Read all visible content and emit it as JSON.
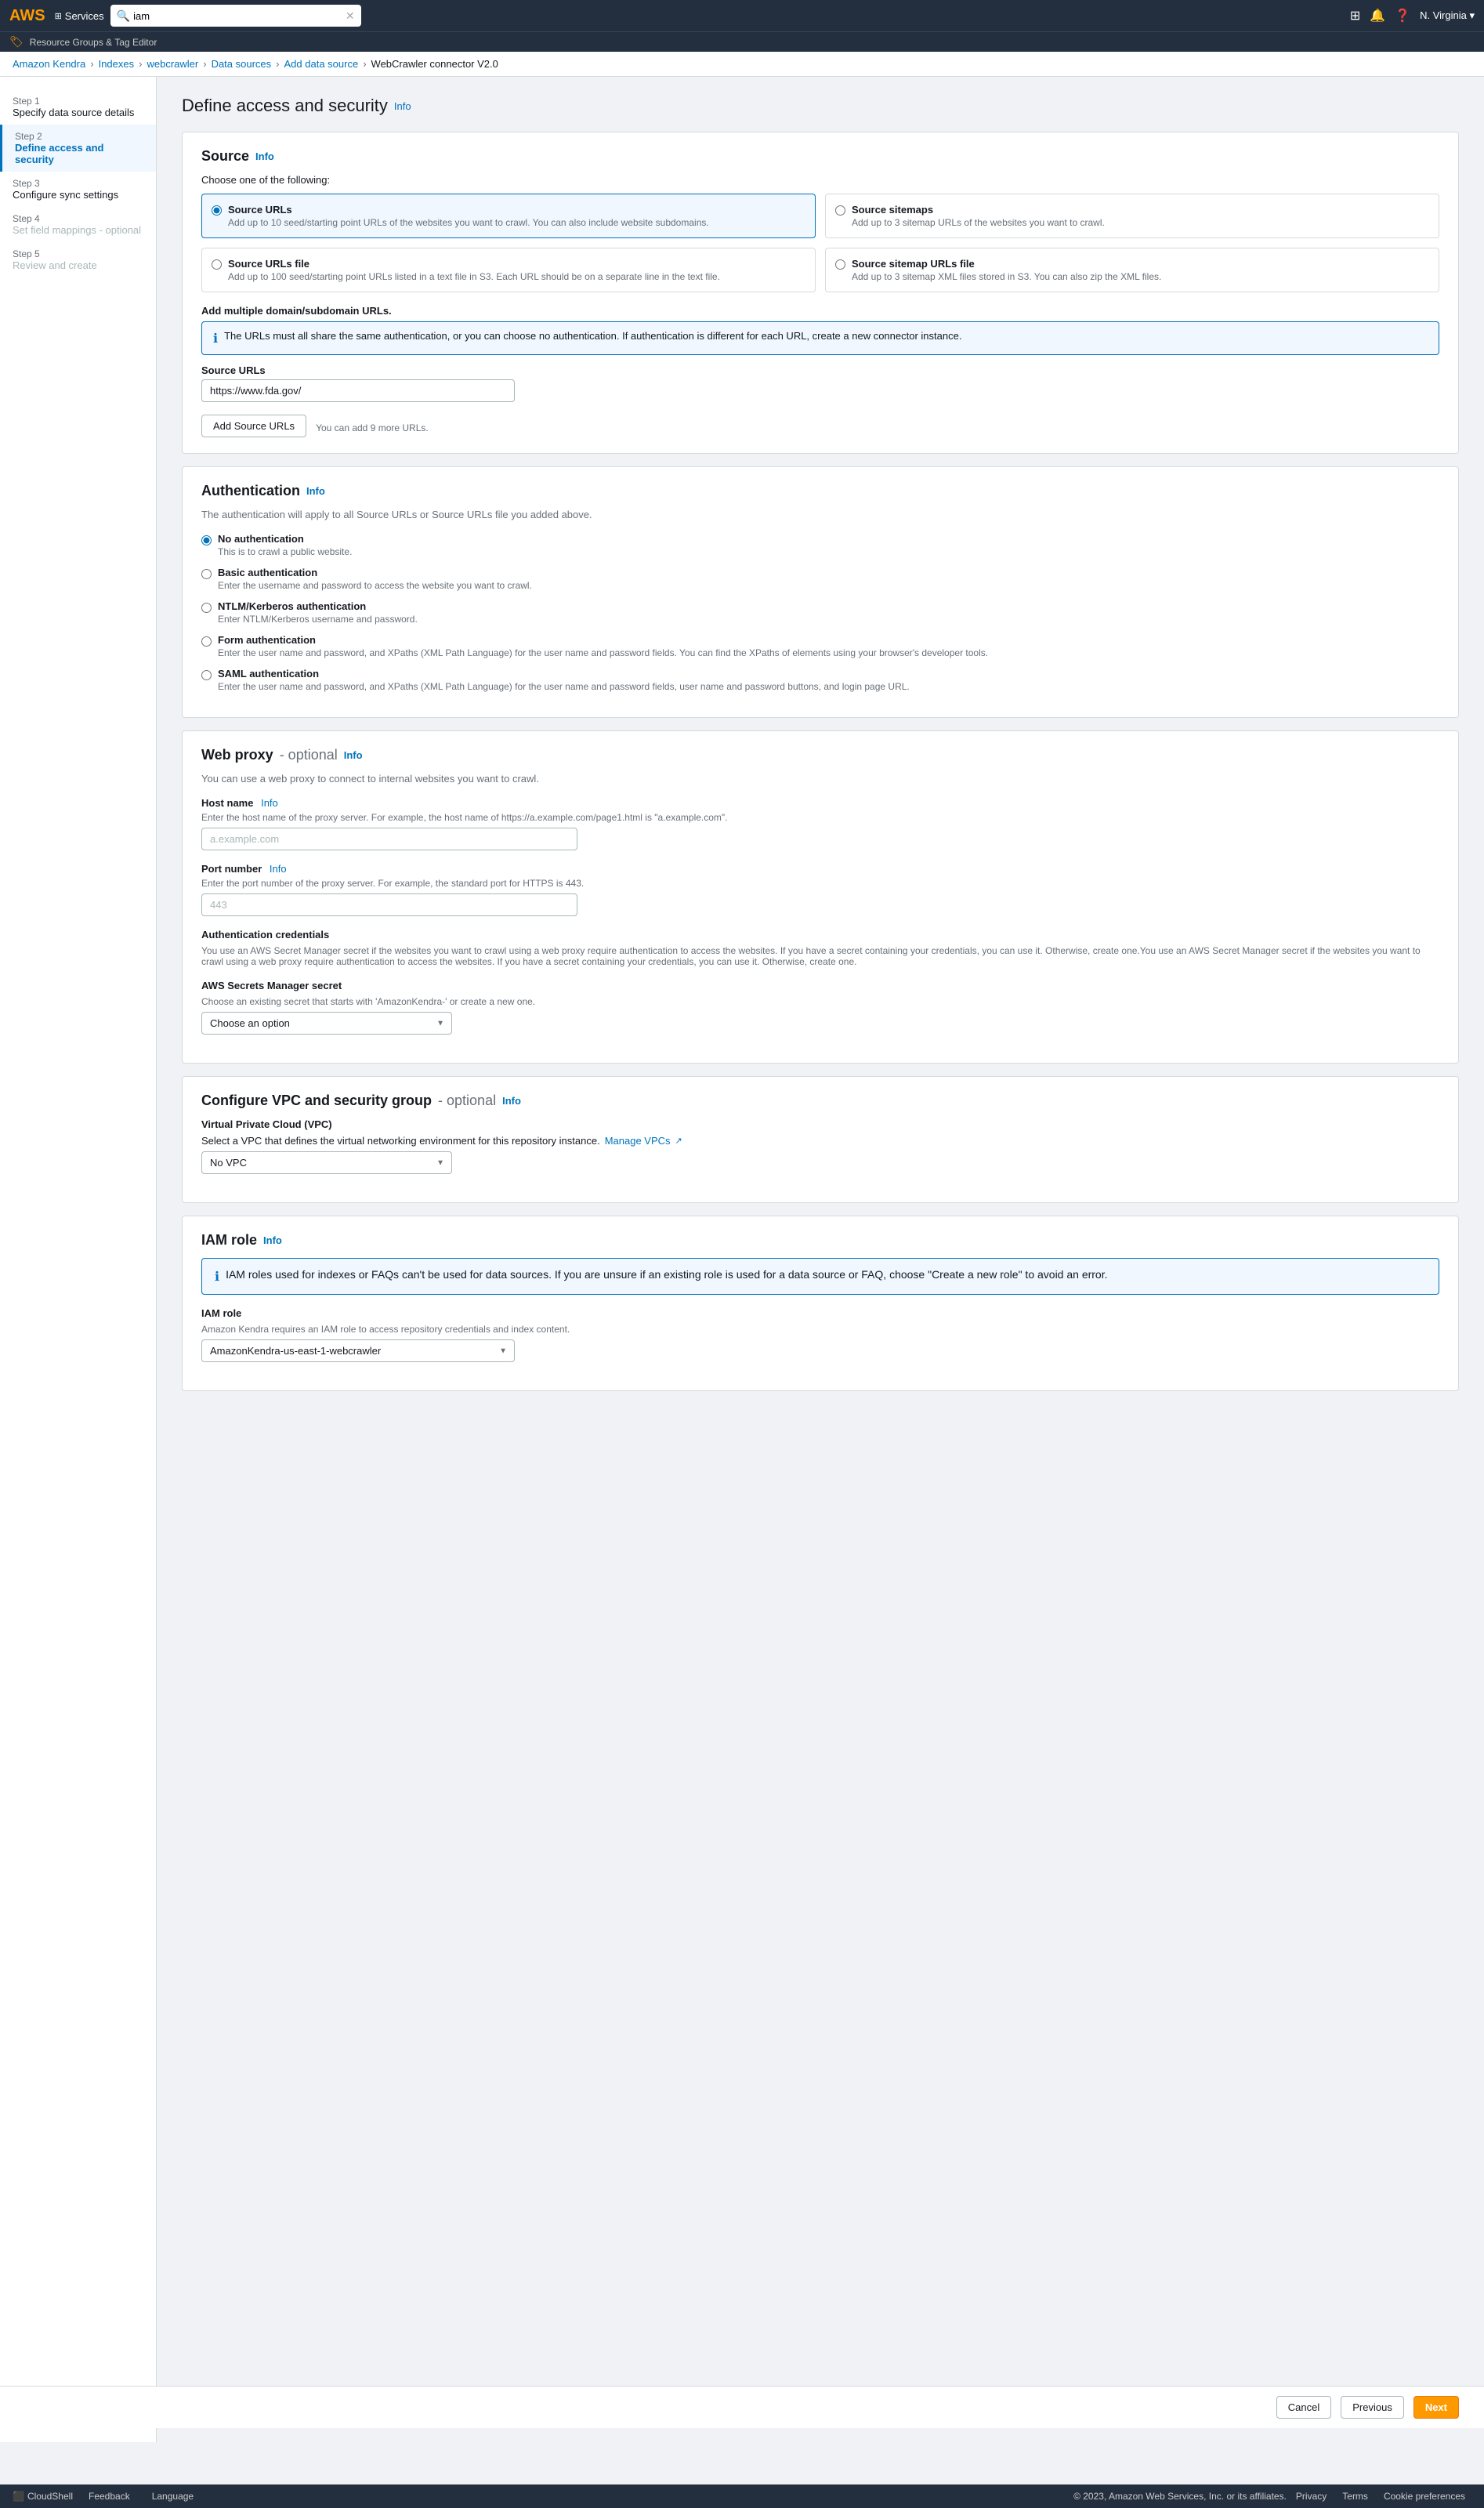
{
  "topNav": {
    "awsLogo": "AWS",
    "servicesLabel": "Services",
    "searchPlaceholder": "iam",
    "region": "N. Virginia ▾"
  },
  "resourceBar": {
    "text": "Resource Groups & Tag Editor"
  },
  "breadcrumb": {
    "items": [
      {
        "label": "Amazon Kendra",
        "href": "#"
      },
      {
        "label": "Indexes",
        "href": "#"
      },
      {
        "label": "webcrawler",
        "href": "#"
      },
      {
        "label": "Data sources",
        "href": "#"
      },
      {
        "label": "Add data source",
        "href": "#"
      },
      {
        "label": "WebCrawler connector V2.0",
        "href": "#"
      }
    ]
  },
  "sidebar": {
    "steps": [
      {
        "num": "Step 1",
        "title": "Specify data source details",
        "state": "inactive"
      },
      {
        "num": "Step 2",
        "title": "Define access and security",
        "state": "active"
      },
      {
        "num": "Step 3",
        "title": "Configure sync settings",
        "state": "inactive"
      },
      {
        "num": "Step 4",
        "title": "Set field mappings - optional",
        "state": "muted"
      },
      {
        "num": "Step 5",
        "title": "Review and create",
        "state": "muted"
      }
    ]
  },
  "pageTitle": "Define access and security",
  "pageTitleInfo": "Info",
  "source": {
    "sectionTitle": "Source",
    "sectionInfo": "Info",
    "chooseLabel": "Choose one of the following:",
    "options": [
      {
        "id": "source-urls",
        "label": "Source URLs",
        "desc": "Add up to 10 seed/starting point URLs of the websites you want to crawl. You can also include website subdomains.",
        "selected": true
      },
      {
        "id": "source-sitemaps",
        "label": "Source sitemaps",
        "desc": "Add up to 3 sitemap URLs of the websites you want to crawl.",
        "selected": false
      },
      {
        "id": "source-urls-file",
        "label": "Source URLs file",
        "desc": "Add up to 100 seed/starting point URLs listed in a text file in S3. Each URL should be on a separate line in the text file.",
        "selected": false
      },
      {
        "id": "source-sitemap-urls-file",
        "label": "Source sitemap URLs file",
        "desc": "Add up to 3 sitemap XML files stored in S3. You can also zip the XML files.",
        "selected": false
      }
    ],
    "multiDomainLabel": "Add multiple domain/subdomain URLs.",
    "infoBoxText": "The URLs must all share the same authentication, or you can choose no authentication. If authentication is different for each URL, create a new connector instance.",
    "sourceUrlsLabel": "Source URLs",
    "sourceUrlValue": "https://www.fda.gov/",
    "addSourceUrlsBtn": "Add Source URLs",
    "canAddMore": "You can add 9 more URLs."
  },
  "authentication": {
    "sectionTitle": "Authentication",
    "sectionInfo": "Info",
    "description": "The authentication will apply to all Source URLs or Source URLs file you added above.",
    "options": [
      {
        "id": "no-auth",
        "label": "No authentication",
        "desc": "This is to crawl a public website.",
        "selected": true
      },
      {
        "id": "basic-auth",
        "label": "Basic authentication",
        "desc": "Enter the username and password to access the website you want to crawl.",
        "selected": false
      },
      {
        "id": "ntlm-auth",
        "label": "NTLM/Kerberos authentication",
        "desc": "Enter NTLM/Kerberos username and password.",
        "selected": false
      },
      {
        "id": "form-auth",
        "label": "Form authentication",
        "desc": "Enter the user name and password, and XPaths (XML Path Language) for the user name and password fields. You can find the XPaths of elements using your browser's developer tools.",
        "selected": false
      },
      {
        "id": "saml-auth",
        "label": "SAML authentication",
        "desc": "Enter the user name and password, and XPaths (XML Path Language) for the user name and password fields, user name and password buttons, and login page URL.",
        "selected": false
      }
    ]
  },
  "webProxy": {
    "sectionTitle": "Web proxy",
    "optionalLabel": "- optional",
    "sectionInfo": "Info",
    "description": "You can use a web proxy to connect to internal websites you want to crawl.",
    "hostNameLabel": "Host name",
    "hostNameInfo": "Info",
    "hostNameDesc": "Enter the host name of the proxy server. For example, the host name of https://a.example.com/page1.html is \"a.example.com\".",
    "hostNamePlaceholder": "a.example.com",
    "portNumberLabel": "Port number",
    "portNumberInfo": "Info",
    "portNumberDesc": "Enter the port number of the proxy server. For example, the standard port for HTTPS is 443.",
    "portNumberPlaceholder": "443",
    "authCredentialsLabel": "Authentication credentials",
    "authCredentialsDesc": "You use an AWS Secret Manager secret if the websites you want to crawl using a web proxy require authentication to access the websites. If you have a secret containing your credentials, you can use it. Otherwise, create one.You use an AWS Secret Manager secret if the websites you want to crawl using a web proxy require authentication to access the websites. If you have a secret containing your credentials, you can use it. Otherwise, create one.",
    "awsSecretLabel": "AWS Secrets Manager secret",
    "awsSecretDesc": "Choose an existing secret that starts with 'AmazonKendra-' or create a new one.",
    "awsSecretPlaceholder": "Choose an option",
    "awsSecretOptions": [
      "Choose an option"
    ]
  },
  "vpc": {
    "sectionTitle": "Configure VPC and security group",
    "optionalLabel": "- optional",
    "sectionInfo": "Info",
    "vpcLabel": "Virtual Private Cloud (VPC)",
    "vpcDesc": "Select a VPC that defines the virtual networking environment for this repository instance.",
    "manageVpcsLabel": "Manage VPCs",
    "vpcOptions": [
      "No VPC"
    ],
    "vpcSelected": "No VPC"
  },
  "iamRole": {
    "sectionTitle": "IAM role",
    "sectionInfo": "Info",
    "alertText": "IAM roles used for indexes or FAQs can't be used for data sources. If you are unsure if an existing role is used for a data source or FAQ, choose \"Create a new role\" to avoid an error.",
    "iamRoleLabel": "IAM role",
    "iamRoleDesc": "Amazon Kendra requires an IAM role to access repository credentials and index content.",
    "iamRoleOptions": [
      "AmazonKendra-us-east-1-webcrawler"
    ],
    "iamRoleSelected": "AmazonKendra-us-east-1-webcrawler"
  },
  "footer": {
    "cancelLabel": "Cancel",
    "previousLabel": "Previous",
    "nextLabel": "Next"
  },
  "footerBottom": {
    "cloudshell": "CloudShell",
    "feedback": "Feedback",
    "language": "Language",
    "copyright": "© 2023, Amazon Web Services, Inc. or its affiliates.",
    "privacy": "Privacy",
    "terms": "Terms",
    "cookiePreferences": "Cookie preferences"
  }
}
